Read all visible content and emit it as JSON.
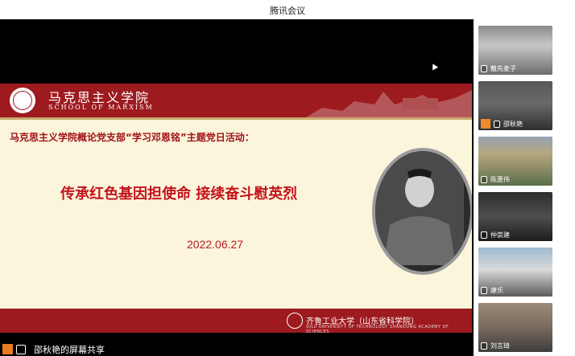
{
  "window": {
    "title": "腾讯会议"
  },
  "slide": {
    "header_title": "马克思主义学院",
    "header_subtitle": "SCHOOL OF MARXISM",
    "subject": "马克思主义学院概论党支部“学习邓恩铭”主题党日活动：",
    "headline": "传承红色基因担使命 接续奋斗慰英烈",
    "date": "2022.06.27",
    "footer_title": "齐鲁工业大学（山东省科学院）",
    "footer_subtitle": "QILU UNIVERSITY OF TECHNOLOGY  SHANDONG ACADEMY OF SCIENCES"
  },
  "share": {
    "label": "邵秋艳的屏幕共享"
  },
  "participants": [
    {
      "name": "戴先麦子"
    },
    {
      "name": "邵秋艳"
    },
    {
      "name": "陈惠伟"
    },
    {
      "name": "仲崇建"
    },
    {
      "name": "康乐"
    },
    {
      "name": "刘言琦"
    }
  ],
  "icons": [
    "mic-icon",
    "avatar-icon",
    "screen-share-icon"
  ]
}
